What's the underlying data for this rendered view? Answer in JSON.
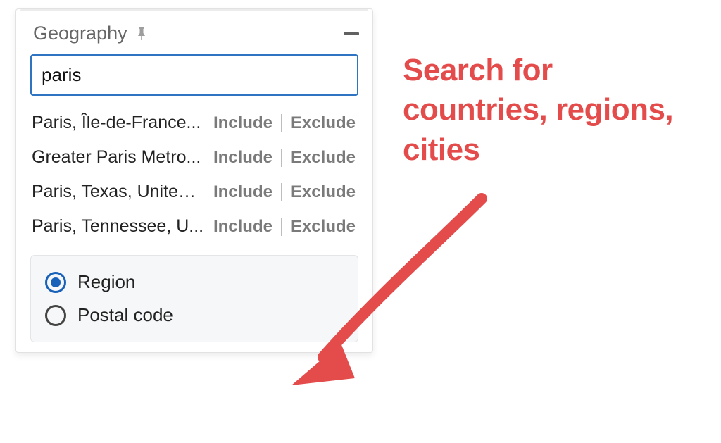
{
  "panel": {
    "title": "Geography",
    "search_value": "paris",
    "collapse_symbol": "minus"
  },
  "results": [
    {
      "name": "Paris, Île-de-France...",
      "include_label": "Include",
      "exclude_label": "Exclude"
    },
    {
      "name": "Greater Paris Metro...",
      "include_label": "Include",
      "exclude_label": "Exclude"
    },
    {
      "name": "Paris, Texas, United ...",
      "include_label": "Include",
      "exclude_label": "Exclude"
    },
    {
      "name": "Paris, Tennessee, U...",
      "include_label": "Include",
      "exclude_label": "Exclude"
    }
  ],
  "modes": {
    "region_label": "Region",
    "postal_label": "Postal code",
    "selected": "region"
  },
  "callout": {
    "text": "Search for countries, regions, cities"
  },
  "colors": {
    "accent_blue": "#1861b9",
    "callout_red": "#e44c4c"
  }
}
